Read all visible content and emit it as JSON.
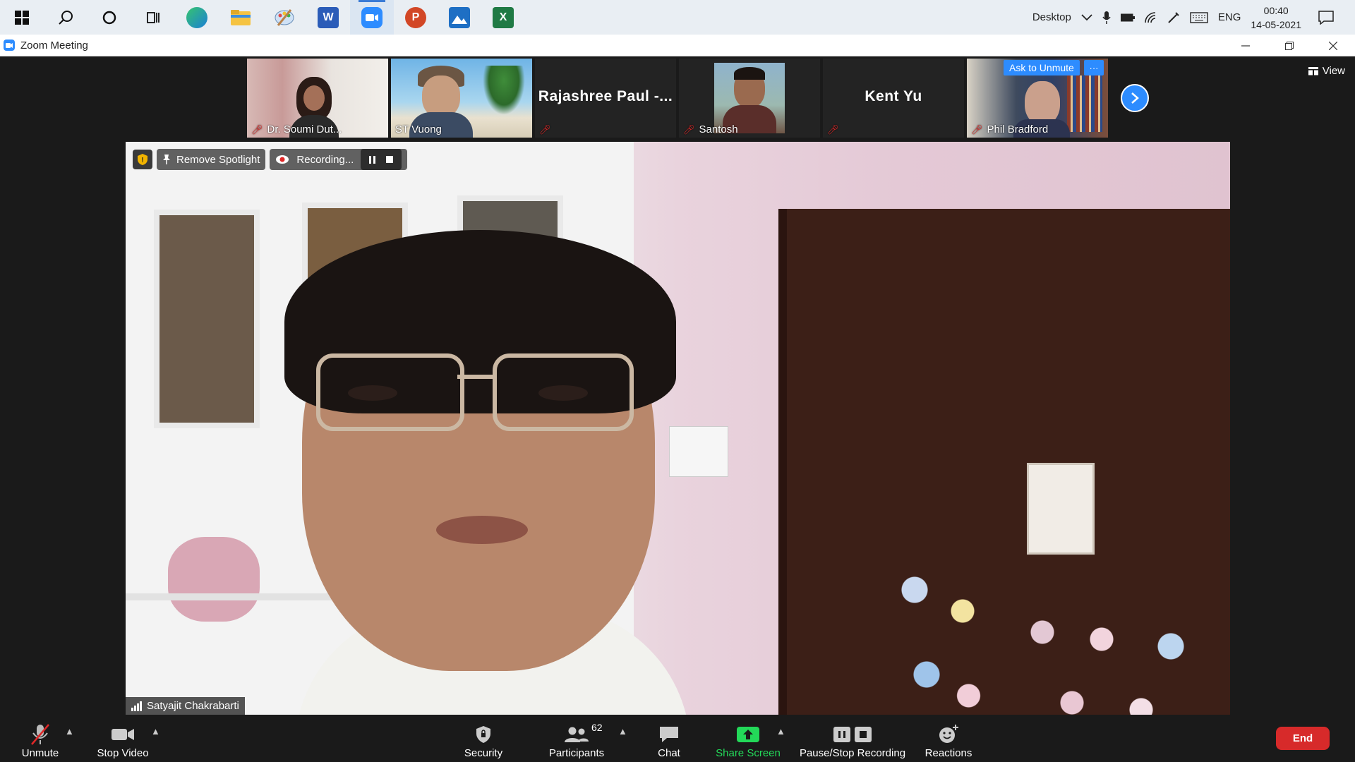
{
  "taskbar": {
    "apps": [
      {
        "name": "start",
        "icon": "windows-icon"
      },
      {
        "name": "search",
        "icon": "search-icon"
      },
      {
        "name": "cortana",
        "icon": "cortana-icon"
      },
      {
        "name": "task-view",
        "icon": "task-view-icon"
      },
      {
        "name": "edge",
        "icon": "edge-icon"
      },
      {
        "name": "file-explorer",
        "icon": "folder-icon"
      },
      {
        "name": "paint",
        "icon": "paint-icon"
      },
      {
        "name": "word",
        "icon": "word-icon",
        "letter": "W"
      },
      {
        "name": "zoom",
        "icon": "zoom-icon"
      },
      {
        "name": "powerpoint",
        "icon": "powerpoint-icon",
        "letter": "P"
      },
      {
        "name": "photos",
        "icon": "photos-icon"
      },
      {
        "name": "excel",
        "icon": "excel-icon",
        "letter": "X"
      }
    ],
    "tray": {
      "desktop_label": "Desktop",
      "lang": "ENG",
      "time": "00:40",
      "date": "14-05-2021"
    }
  },
  "window": {
    "title": "Zoom Meeting"
  },
  "meeting": {
    "view_label": "View",
    "participants_strip": [
      {
        "name": "Dr. Soumi Dut...",
        "video": true,
        "muted": true
      },
      {
        "name": "ST Vuong",
        "video": true,
        "muted": false
      },
      {
        "name": "Rajashree  Paul  -...",
        "video": false,
        "muted": true
      },
      {
        "name": "Santosh",
        "video": true,
        "muted": true
      },
      {
        "name": "Kent Yu",
        "video": false,
        "muted": true
      },
      {
        "name": "Phil Bradford",
        "video": true,
        "muted": true,
        "ask_unmute": "Ask to Unmute",
        "more": "···"
      }
    ],
    "spotlight_label": "Remove Spotlight",
    "recording_label": "Recording...",
    "speaker_name": "Satyajit Chakrabarti"
  },
  "toolbar": {
    "unmute": "Unmute",
    "stop_video": "Stop Video",
    "security": "Security",
    "participants": "Participants",
    "participants_count": "62",
    "chat": "Chat",
    "share_screen": "Share Screen",
    "pause_stop_recording": "Pause/Stop Recording",
    "reactions": "Reactions",
    "end": "End"
  },
  "colors": {
    "zoom_blue": "#2d8cff",
    "end_red": "#d72a2a",
    "share_green": "#23d959",
    "mute_red": "#e02828"
  }
}
